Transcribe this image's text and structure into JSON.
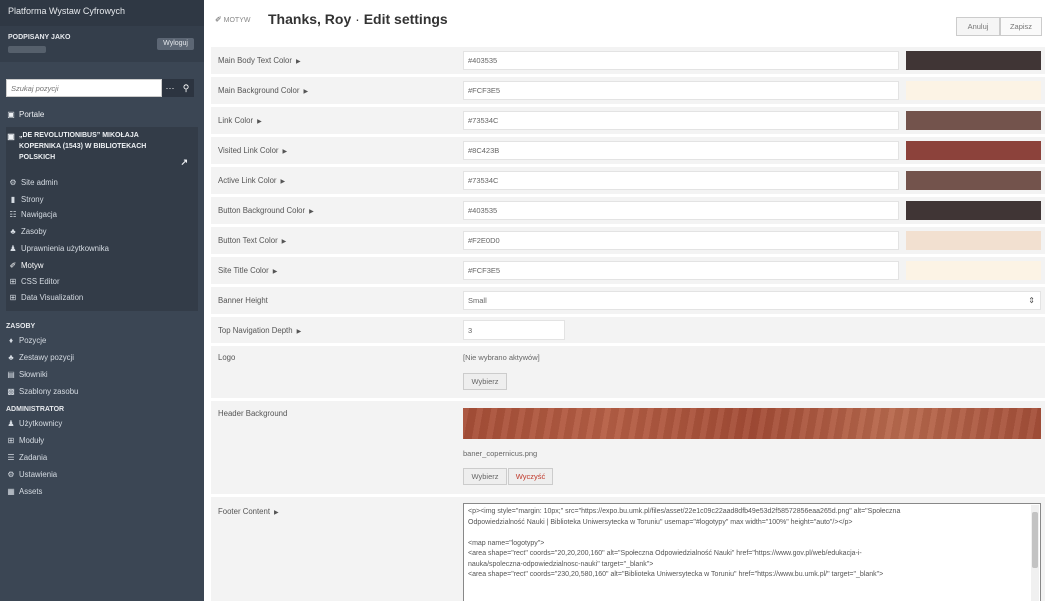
{
  "sidebar": {
    "app_title": "Platforma Wystaw Cyfrowych",
    "signed_as": "PODPISANY JAKO",
    "logout": "Wyloguj",
    "search_placeholder": "Szukaj pozycji",
    "portals": "Portale",
    "site_title": "„DE REVOLUTIONIBUS” MIKOŁAJA KOPERNIKA (1543) W BIBLIOTEKACH POLSKICH",
    "site_items": [
      "Site admin",
      "Strony",
      "Nawigacja",
      "Zasoby",
      "Uprawnienia użytkownika",
      "Motyw",
      "CSS Editor",
      "Data Visualization"
    ],
    "resources_heading": "ZASOBY",
    "resources_items": [
      "Pozycje",
      "Zestawy pozycji",
      "Słowniki",
      "Szablony zasobu"
    ],
    "admin_heading": "ADMINISTRATOR",
    "admin_items": [
      "Użytkownicy",
      "Moduły",
      "Zadania",
      "Ustawienia",
      "Assets"
    ]
  },
  "header": {
    "badge": "MOTYW",
    "title": "Thanks, Roy",
    "separator": "·",
    "subtitle": "Edit settings",
    "cancel": "Anuluj",
    "save": "Zapisz"
  },
  "settings": {
    "main_body_text_color": {
      "label": "Main Body Text Color",
      "value": "#403535",
      "swatch": "#403535"
    },
    "main_background_color": {
      "label": "Main Background Color",
      "value": "#FCF3E5",
      "swatch": "#FCF3E5"
    },
    "link_color": {
      "label": "Link Color",
      "value": "#73534C",
      "swatch": "#73534C"
    },
    "visited_link_color": {
      "label": "Visited Link Color",
      "value": "#8C423B",
      "swatch": "#8C423B"
    },
    "active_link_color": {
      "label": "Active Link Color",
      "value": "#73534C",
      "swatch": "#73534C"
    },
    "button_background_color": {
      "label": "Button Background Color",
      "value": "#403535",
      "swatch": "#403535"
    },
    "button_text_color": {
      "label": "Button Text Color",
      "value": "#F2E0D0",
      "swatch": "#F2E0D0"
    },
    "site_title_color": {
      "label": "Site Title Color",
      "value": "#FCF3E5",
      "swatch": "#FCF3E5"
    },
    "banner_height": {
      "label": "Banner Height",
      "value": "Small"
    },
    "top_navigation_depth": {
      "label": "Top Navigation Depth",
      "value": "3"
    },
    "logo": {
      "label": "Logo",
      "none": "[Nie wybrano aktywów]",
      "choose": "Wybierz"
    },
    "header_background": {
      "label": "Header Background",
      "filename": "baner_copernicus.png",
      "choose": "Wybierz",
      "clear": "Wyczyść"
    },
    "footer_content": {
      "label": "Footer Content",
      "lines": [
        "<p><img style=\"margin: 10px;\" src=\"https://expo.bu.umk.pl/files/asset/22e1c09c22aad8dfb49e53d2f58572856eaa265d.png\" alt=\"Społeczna",
        "Odpowiedzialność Nauki | Biblioteka Uniwersytecka w Toruniu\" usemap=\"#logotypy\" max width=\"100%\" height=\"auto\"/></p>",
        "",
        "<map name=\"logotypy\">",
        "  <area shape=\"rect\" coords=\"20,20,200,160\" alt=\"Społeczna Odpowiedzialność Nauki\" href=\"https://www.gov.pl/web/edukacja-i-",
        "nauka/spoleczna-odpowiedzialnosc-nauki\" target=\"_blank\">",
        "  <area shape=\"rect\" coords=\"230,20,580,160\" alt=\"Biblioteka Uniwersytecka w Toruniu\" href=\"https://www.bu.umk.pl/\" target=\"_blank\">"
      ]
    }
  }
}
